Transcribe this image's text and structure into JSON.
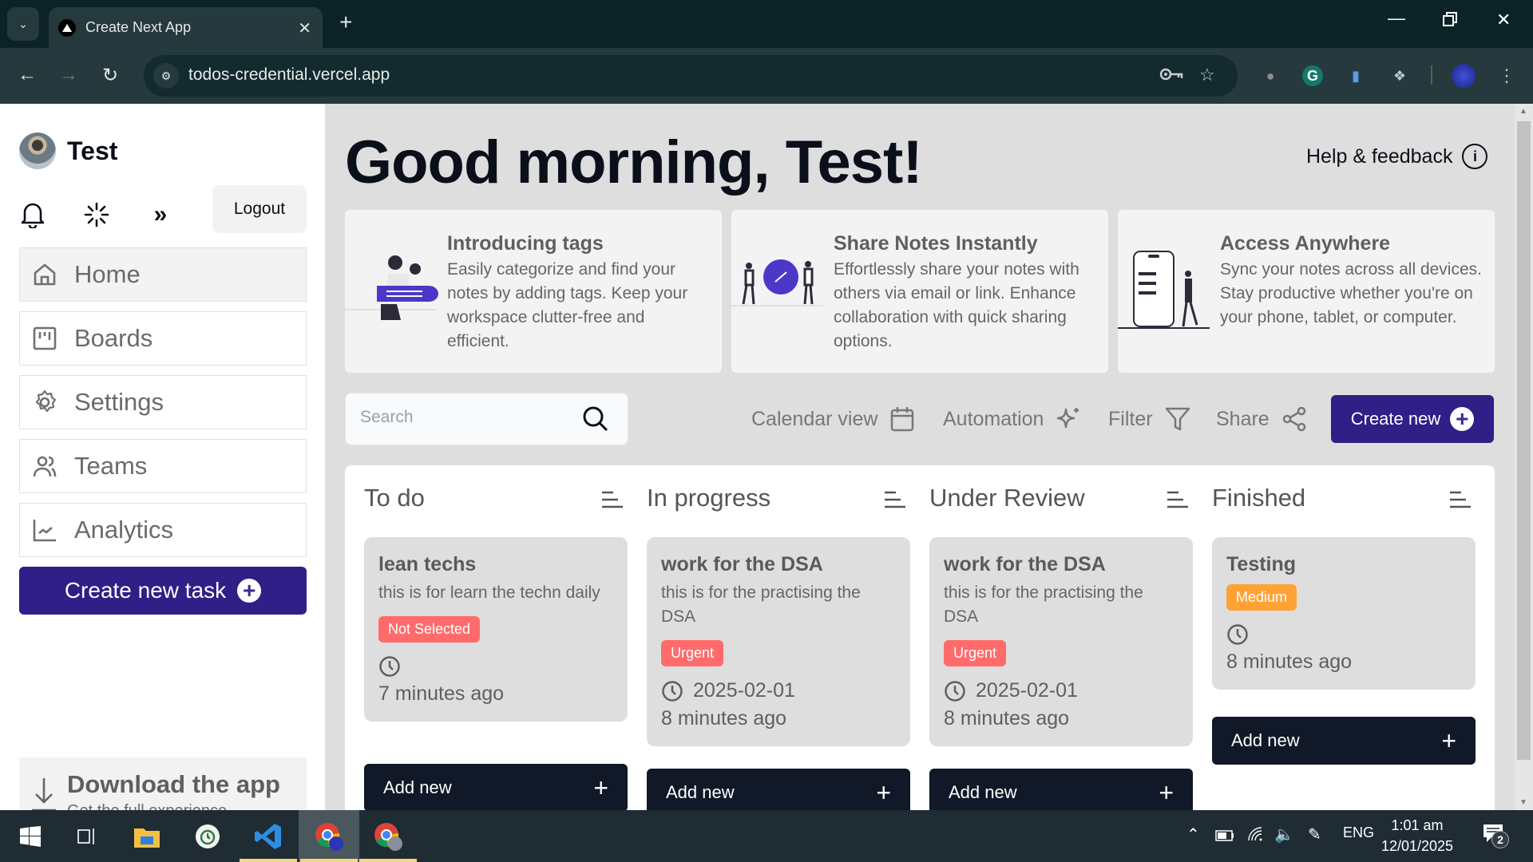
{
  "browser": {
    "tab_title": "Create Next App",
    "url": "todos-credential.vercel.app"
  },
  "sidebar": {
    "username": "Test",
    "logout_label": "Logout",
    "nav_items": [
      {
        "label": "Home",
        "icon": "home-icon",
        "active": true
      },
      {
        "label": "Boards",
        "icon": "boards-icon",
        "active": false
      },
      {
        "label": "Settings",
        "icon": "gear-icon",
        "active": false
      },
      {
        "label": "Teams",
        "icon": "users-icon",
        "active": false
      },
      {
        "label": "Analytics",
        "icon": "chart-line-icon",
        "active": false
      }
    ],
    "create_task_label": "Create new task",
    "download": {
      "title": "Download the app",
      "subtitle": "Get the full experience"
    }
  },
  "main": {
    "greeting": "Good morning, Test!",
    "help_label": "Help & feedback",
    "promos": [
      {
        "title": "Introducing tags",
        "body": "Easily categorize and find your notes by adding tags. Keep your workspace clutter-free and efficient."
      },
      {
        "title": "Share Notes Instantly",
        "body": "Effortlessly share your notes with others via email or link. Enhance collaboration with quick sharing options."
      },
      {
        "title": "Access Anywhere",
        "body": "Sync your notes across all devices. Stay productive whether you're on your phone, tablet, or computer."
      }
    ],
    "search": {
      "placeholder": "Search",
      "value": ""
    },
    "tools": {
      "calendar": "Calendar view",
      "automation": "Automation",
      "filter": "Filter",
      "share": "Share"
    },
    "create_new_label": "Create new",
    "columns": [
      {
        "title": "To do",
        "add_label": "Add new",
        "cards": [
          {
            "title": "lean techs",
            "description": "this is for learn the techn daily",
            "priority": "Not Selected",
            "priority_color": "#ff6b6b",
            "deadline": "",
            "created": "7 minutes ago"
          }
        ]
      },
      {
        "title": "In progress",
        "add_label": "Add new",
        "cards": [
          {
            "title": "work for the DSA",
            "description": "this is for the practising the DSA",
            "priority": "Urgent",
            "priority_color": "#ff6b6b",
            "deadline": "2025-02-01",
            "created": "8 minutes ago"
          }
        ]
      },
      {
        "title": "Under Review",
        "add_label": "Add new",
        "cards": [
          {
            "title": "work for the DSA",
            "description": "this is for the practising the DSA",
            "priority": "Urgent",
            "priority_color": "#ff6b6b",
            "deadline": "2025-02-01",
            "created": "8 minutes ago"
          }
        ]
      },
      {
        "title": "Finished",
        "add_label": "Add new",
        "cards": [
          {
            "title": "Testing",
            "description": "",
            "priority": "Medium",
            "priority_color": "#ffa235",
            "deadline": "",
            "created": "8 minutes ago"
          }
        ]
      }
    ]
  },
  "colors": {
    "accent": "#2f1f87",
    "dark_button": "#111827",
    "urgent": "#ff6b6b",
    "medium": "#ffa235"
  },
  "taskbar": {
    "language": "ENG",
    "time": "1:01 am",
    "date": "12/01/2025",
    "notification_count": "2"
  }
}
